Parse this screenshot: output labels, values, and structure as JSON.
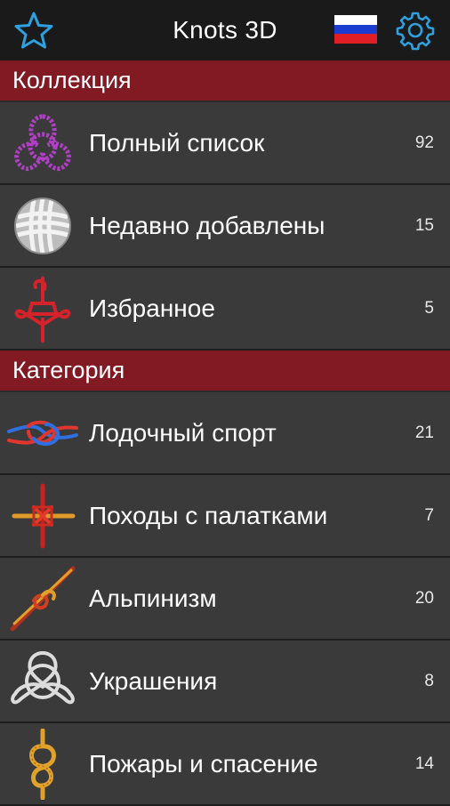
{
  "header": {
    "title": "Knots 3D"
  },
  "collection": {
    "heading": "Коллекция",
    "items": [
      {
        "label": "Полный список",
        "count": "92"
      },
      {
        "label": "Недавно добавлены",
        "count": "15"
      },
      {
        "label": "Избранное",
        "count": "5"
      }
    ]
  },
  "category": {
    "heading": "Категория",
    "items": [
      {
        "label": "Лодочный спорт",
        "count": "21"
      },
      {
        "label": "Походы с палатками",
        "count": "7"
      },
      {
        "label": "Альпинизм",
        "count": "20"
      },
      {
        "label": "Украшения",
        "count": "8"
      },
      {
        "label": "Пожары и спасение",
        "count": "14"
      }
    ]
  },
  "icons": [
    "star-icon",
    "russian-flag-icon",
    "gear-icon",
    "trefoil-knot-icon",
    "monkey-fist-knot-icon",
    "heart-knot-icon",
    "reef-knot-icon",
    "square-lashing-icon",
    "climbing-knot-icon",
    "celtic-knot-icon",
    "figure-eight-knot-icon"
  ],
  "colors": {
    "accent": "#2fa0e0",
    "section_bg": "#821a24",
    "row_bg": "#3a3a3a",
    "topbar_bg": "#1a1a1a"
  }
}
